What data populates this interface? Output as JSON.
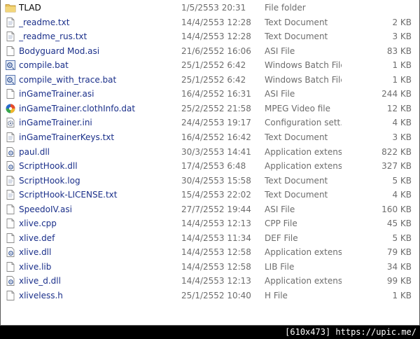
{
  "files": [
    {
      "name": "TLAD",
      "date": "1/5/2553 20:31",
      "type": "File folder",
      "size": "",
      "icon": "folder-icon",
      "name_color": "#000000"
    },
    {
      "name": "_readme.txt",
      "date": "14/4/2553 12:28",
      "type": "Text Document",
      "size": "2 KB",
      "icon": "text-document-icon"
    },
    {
      "name": "_readme_rus.txt",
      "date": "14/4/2553 12:28",
      "type": "Text Document",
      "size": "3 KB",
      "icon": "text-document-icon"
    },
    {
      "name": "Bodyguard Mod.asi",
      "date": "21/6/2552 16:06",
      "type": "ASI File",
      "size": "83 KB",
      "icon": "generic-file-icon"
    },
    {
      "name": "compile.bat",
      "date": "25/1/2552 6:42",
      "type": "Windows Batch File",
      "size": "1 KB",
      "icon": "batch-file-icon"
    },
    {
      "name": "compile_with_trace.bat",
      "date": "25/1/2552 6:42",
      "type": "Windows Batch File",
      "size": "1 KB",
      "icon": "batch-file-icon"
    },
    {
      "name": "inGameTrainer.asi",
      "date": "16/4/2552 16:31",
      "type": "ASI File",
      "size": "244 KB",
      "icon": "generic-file-icon"
    },
    {
      "name": "inGameTrainer.clothInfo.dat",
      "date": "25/2/2552 21:58",
      "type": "MPEG Video file",
      "size": "12 KB",
      "icon": "video-file-icon"
    },
    {
      "name": "inGameTrainer.ini",
      "date": "24/4/2553 19:17",
      "type": "Configuration sett...",
      "size": "4 KB",
      "icon": "config-file-icon"
    },
    {
      "name": "inGameTrainerKeys.txt",
      "date": "16/4/2552 16:42",
      "type": "Text Document",
      "size": "3 KB",
      "icon": "text-document-icon"
    },
    {
      "name": "paul.dll",
      "date": "30/3/2553 14:41",
      "type": "Application extens...",
      "size": "822 KB",
      "icon": "dll-file-icon"
    },
    {
      "name": "ScriptHook.dll",
      "date": "17/4/2553 6:48",
      "type": "Application extens...",
      "size": "327 KB",
      "icon": "dll-file-icon"
    },
    {
      "name": "ScriptHook.log",
      "date": "30/4/2553 15:58",
      "type": "Text Document",
      "size": "5 KB",
      "icon": "text-document-icon"
    },
    {
      "name": "ScriptHook-LICENSE.txt",
      "date": "15/4/2553 22:02",
      "type": "Text Document",
      "size": "4 KB",
      "icon": "text-document-icon"
    },
    {
      "name": "SpeedoIV.asi",
      "date": "27/7/2552 19:44",
      "type": "ASI File",
      "size": "160 KB",
      "icon": "generic-file-icon"
    },
    {
      "name": "xlive.cpp",
      "date": "14/4/2553 12:13",
      "type": "CPP File",
      "size": "45 KB",
      "icon": "generic-file-icon"
    },
    {
      "name": "xlive.def",
      "date": "14/4/2553 11:34",
      "type": "DEF File",
      "size": "5 KB",
      "icon": "generic-file-icon"
    },
    {
      "name": "xlive.dll",
      "date": "14/4/2553 12:58",
      "type": "Application extens...",
      "size": "79 KB",
      "icon": "dll-file-icon"
    },
    {
      "name": "xlive.lib",
      "date": "14/4/2553 12:58",
      "type": "LIB File",
      "size": "34 KB",
      "icon": "generic-file-icon"
    },
    {
      "name": "xlive_d.dll",
      "date": "14/4/2553 12:13",
      "type": "Application extens...",
      "size": "99 KB",
      "icon": "dll-file-icon"
    },
    {
      "name": "xliveless.h",
      "date": "25/1/2552 10:40",
      "type": "H File",
      "size": "1 KB",
      "icon": "generic-file-icon"
    }
  ],
  "watermark": "[610x473] https://upic.me/",
  "colors": {
    "name_text": "#1a2f8a",
    "meta_text": "#6d6d6d",
    "folder": "#e8c15a",
    "footer_bg": "#000000"
  }
}
